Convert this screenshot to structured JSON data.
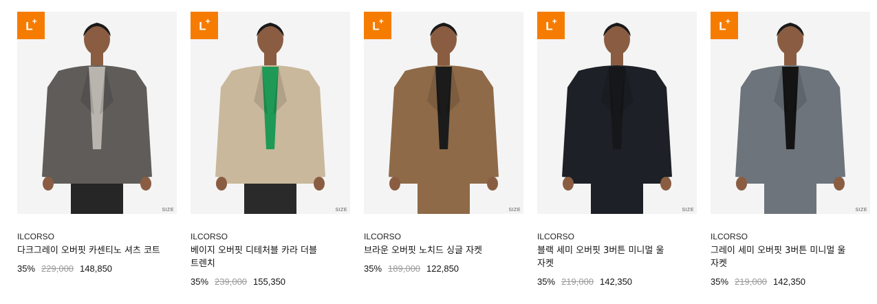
{
  "badge_text": "L",
  "badge_plus": "+",
  "size_label": "SIZE",
  "products": [
    {
      "brand": "ILCORSO",
      "name": "다크그레이 오버핏 카센티노 셔츠 코트",
      "discount": "35%",
      "original_price": "229,000",
      "sale_price": "148,850",
      "coat_color": "#5f5c5a",
      "inner_color": "#b9b5ae",
      "pants_color": "#262626"
    },
    {
      "brand": "ILCORSO",
      "name": "베이지 오버핏 디테처블 카라 더블 트렌치",
      "discount": "35%",
      "original_price": "239,000",
      "sale_price": "155,350",
      "coat_color": "#c9b89b",
      "inner_color": "#1f9a56",
      "pants_color": "#2a2a2a"
    },
    {
      "brand": "ILCORSO",
      "name": "브라운 오버핏 노치드 싱글 자켓",
      "discount": "35%",
      "original_price": "189,000",
      "sale_price": "122,850",
      "coat_color": "#8e6a48",
      "inner_color": "#1b1b1b",
      "pants_color": "#8e6a48"
    },
    {
      "brand": "ILCORSO",
      "name": "블랙 세미 오버핏 3버튼 미니멀 울 자켓",
      "discount": "35%",
      "original_price": "219,000",
      "sale_price": "142,350",
      "coat_color": "#1d2026",
      "inner_color": "#15171a",
      "pants_color": "#1d2026"
    },
    {
      "brand": "ILCORSO",
      "name": "그레이 세미 오버핏 3버튼 미니멀 울 자켓",
      "discount": "35%",
      "original_price": "219,000",
      "sale_price": "142,350",
      "coat_color": "#6d747b",
      "inner_color": "#141414",
      "pants_color": "#6d747b"
    }
  ]
}
